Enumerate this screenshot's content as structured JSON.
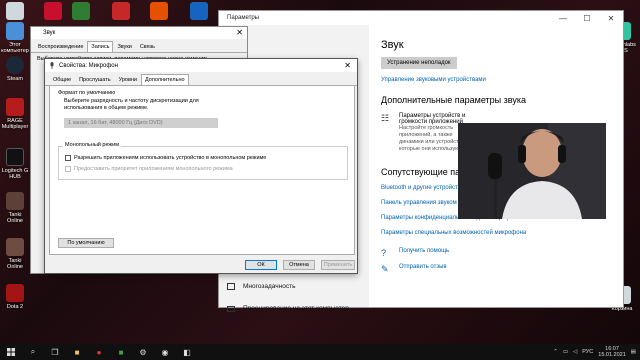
{
  "desktop": {
    "top_icons": [
      {
        "name": "acrobat",
        "color": "#c8102e"
      },
      {
        "name": "app-green",
        "color": "#2e7d32"
      },
      {
        "name": "app-red",
        "color": "#c62828"
      },
      {
        "name": "app-orange",
        "color": "#e65100"
      },
      {
        "name": "app-blue",
        "color": "#1565c0"
      },
      {
        "name": "app-white",
        "color": "#eeeeee"
      },
      {
        "name": "app-red2",
        "color": "#d32f2f"
      }
    ],
    "left_icons": [
      {
        "label": "Этот компьютер",
        "color": "#4a90d9"
      },
      {
        "label": "Steam",
        "color": "#1b2838"
      },
      {
        "label": "RAGE Multiplayer",
        "color": "#b71c1c"
      },
      {
        "label": "Logitech G HUB",
        "color": "#111111"
      },
      {
        "label": "Tanki Online",
        "color": "#5d4037"
      },
      {
        "label": "Tanki Online",
        "color": "#6d4c41"
      },
      {
        "label": "Dota 2",
        "color": "#a31515"
      }
    ],
    "right_icons": [
      {
        "label": "Streamlabs OBS",
        "color": "#31c3a2"
      },
      {
        "label": "Корзина",
        "color": "#cfd8dc"
      }
    ]
  },
  "settings": {
    "title": "Параметры",
    "controls": {
      "minimize": "—",
      "maximize": "☐",
      "close": "✕"
    },
    "heading": "Звук",
    "troubleshoot_btn": "Устранение неполадок",
    "manage_devices_link": "Управление звуковыми устройствами",
    "advanced_heading": "Дополнительные параметры звука",
    "app_volume_title": "Параметры устройств и громкости приложений",
    "app_volume_sub": "Настройте громкость приложений, а также динамики или устройства, которые они используют.",
    "related_heading": "Сопутствующие параметры",
    "related_links": [
      "Bluetooth и другие устройства",
      "Панель управления звуком",
      "Параметры конфиденциальности для микрофона",
      "Параметры специальных возможностей микрофона"
    ],
    "help_link": "Получить помощь",
    "feedback_link": "Отправить отзыв",
    "left_items": [
      "Многозадачность",
      "Проецирование на этот компьютер"
    ]
  },
  "sound_dialog": {
    "title": "Звук",
    "tabs": [
      "Воспроизведение",
      "Запись",
      "Звуки",
      "Связь"
    ],
    "active_tab": "Запись",
    "hint": "Выберите устройство записи, параметры которого нужно изменить"
  },
  "props_dialog": {
    "title": "Свойства: Микрофон",
    "close": "✕",
    "tabs": [
      "Общие",
      "Прослушать",
      "Уровни",
      "Дополнительно"
    ],
    "active_tab": "Дополнительно",
    "default_format": {
      "label": "Формат по умолчанию",
      "desc": "Выберите разрядность и частоту дискретизации для использования в общем режиме.",
      "selected": "1 канал, 16 бит, 48000 Гц (Диск DVD)"
    },
    "exclusive": {
      "label": "Монопольный режим",
      "allow": "Разрешить приложениям использовать устройство в монопольном режиме",
      "priority": "Предоставить приоритет приложениям монопольного режима"
    },
    "defaults_btn": "По умолчанию",
    "ok_btn": "ОК",
    "cancel_btn": "Отмена",
    "apply_btn": "Применить"
  },
  "taskbar": {
    "lang": "РУС",
    "time": "16:07",
    "date": "15.01.2021"
  }
}
